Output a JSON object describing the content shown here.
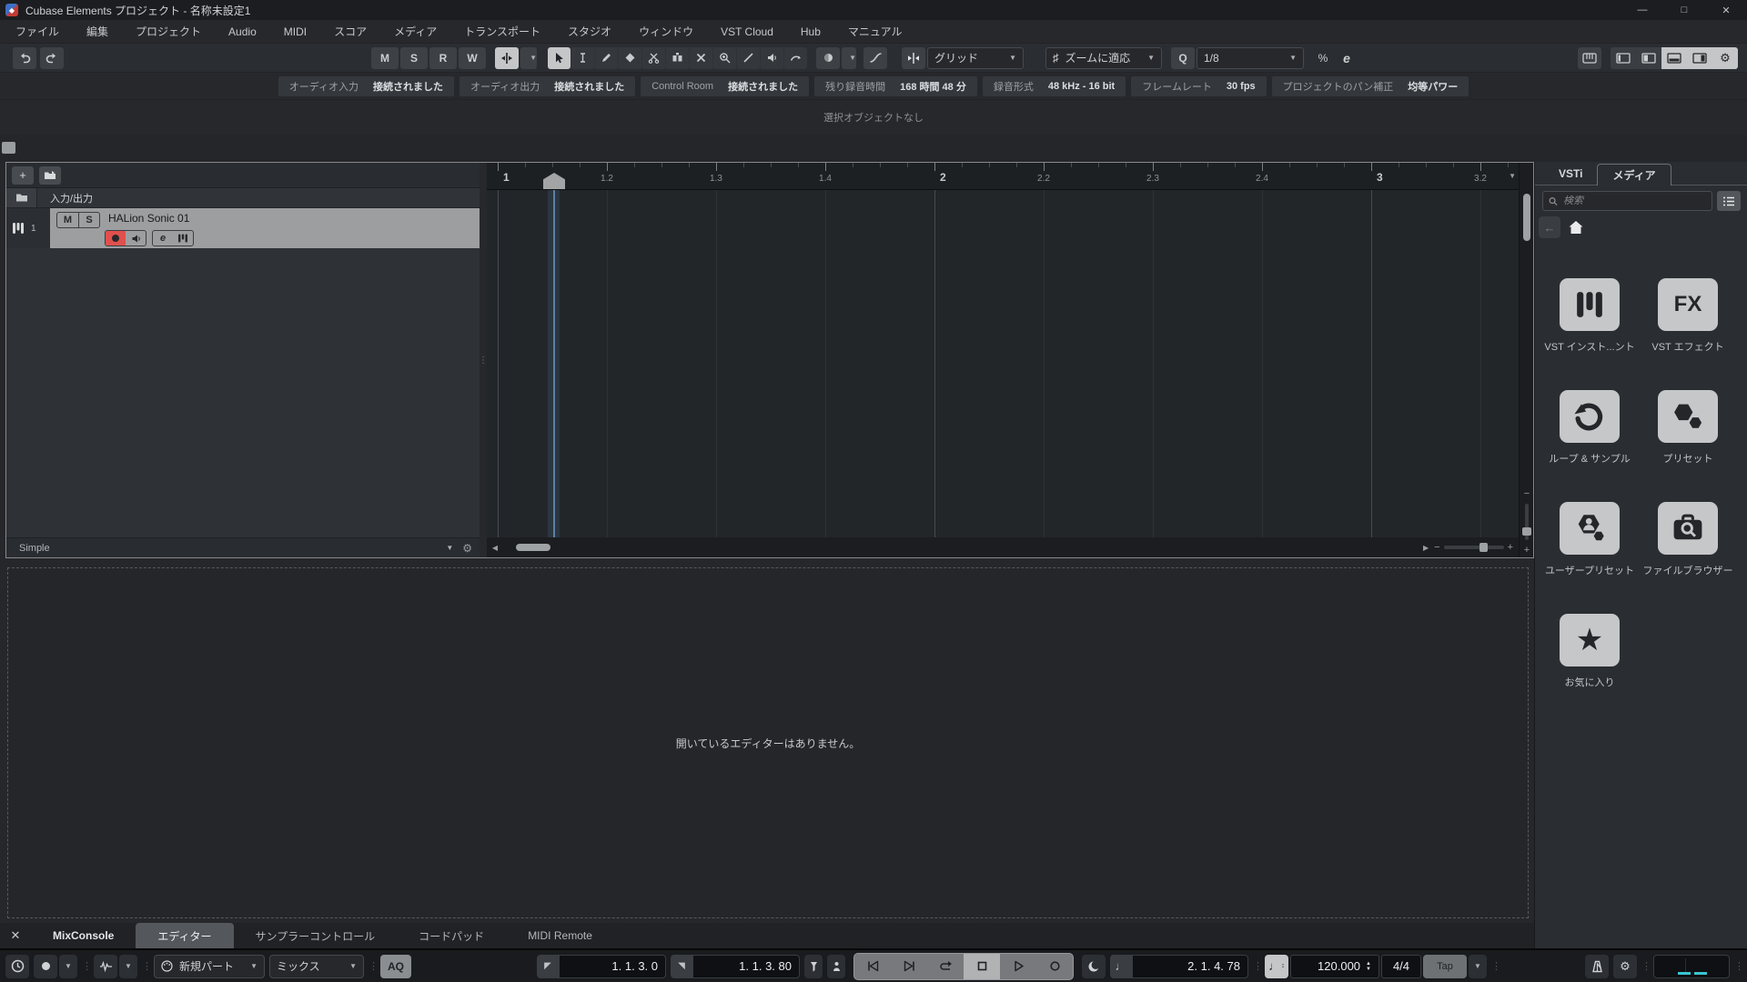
{
  "window": {
    "title": "Cubase Elements プロジェクト - 名称未設定1",
    "minimize": "—",
    "maximize": "□",
    "close": "✕"
  },
  "menu": {
    "items": [
      "ファイル",
      "編集",
      "プロジェクト",
      "Audio",
      "MIDI",
      "スコア",
      "メディア",
      "トランスポート",
      "スタジオ",
      "ウィンドウ",
      "VST Cloud",
      "Hub",
      "マニュアル"
    ]
  },
  "toolbar": {
    "monitor_buttons": [
      "M",
      "S",
      "R",
      "W"
    ],
    "grid_type": "グリッド",
    "zoom_preset": "ズームに適応",
    "quantize_preset": "1/8",
    "iterative_quantize": "%",
    "quantize_panel": "e"
  },
  "status_bar": {
    "items": [
      {
        "label": "オーディオ入力",
        "value": "接続されました"
      },
      {
        "label": "オーディオ出力",
        "value": "接続されました"
      },
      {
        "label": "Control Room",
        "value": "接続されました"
      },
      {
        "label": "残り録音時間",
        "value": "168 時間 48 分"
      },
      {
        "label": "録音形式",
        "value": "48 kHz - 16 bit"
      },
      {
        "label": "フレームレート",
        "value": "30 fps"
      },
      {
        "label": "プロジェクトのパン補正",
        "value": "均等パワー"
      }
    ]
  },
  "info_line": {
    "text": "選択オブジェクトなし"
  },
  "track_area": {
    "folder_track": {
      "name": "入力/出力"
    },
    "instrument_track": {
      "number": "1",
      "name": "HALion Sonic 01",
      "mute": "M",
      "solo": "S",
      "edit": "e"
    },
    "workspace_preset": "Simple"
  },
  "ruler": {
    "labels": [
      "1",
      "1.2",
      "1.3",
      "1.4",
      "2",
      "2.2",
      "2.3",
      "2.4",
      "3",
      "3.2"
    ]
  },
  "lower_zone": {
    "message": "開いているエディターはありません。",
    "tabs": [
      {
        "label": "MixConsole",
        "active": false
      },
      {
        "label": "エディター",
        "active": true
      },
      {
        "label": "サンプラーコントロール",
        "active": false
      },
      {
        "label": "コードパッド",
        "active": false
      },
      {
        "label": "MIDI Remote",
        "active": false
      }
    ]
  },
  "right_zone": {
    "tabs": [
      {
        "label": "VSTi",
        "active": false
      },
      {
        "label": "メディア",
        "active": true
      }
    ],
    "search_placeholder": "検索",
    "tiles": [
      {
        "label": "VST インスト...ント",
        "icon": "instrument"
      },
      {
        "label": "VST エフェクト",
        "icon": "fx"
      },
      {
        "label": "ループ & サンプル",
        "icon": "loops"
      },
      {
        "label": "プリセット",
        "icon": "presets"
      },
      {
        "label": "ユーザープリセット",
        "icon": "user-presets"
      },
      {
        "label": "ファイルブラウザー",
        "icon": "file-browser"
      },
      {
        "label": "お気に入り",
        "icon": "favorites"
      }
    ]
  },
  "transport": {
    "midi_record_mode": "新規パート",
    "midi_record_mix": "ミックス",
    "auto_quantize": "AQ",
    "left_locator": "1. 1. 3. 0",
    "right_locator": "1. 1. 3. 80",
    "time_display": "2. 1. 4. 78",
    "tempo": "120.000",
    "time_signature": "4/4",
    "tap": "Tap"
  },
  "colors": {
    "accent_red": "#e0504c",
    "meter_cyan": "#39c6d2",
    "selected_track": "#9d9ea0"
  }
}
